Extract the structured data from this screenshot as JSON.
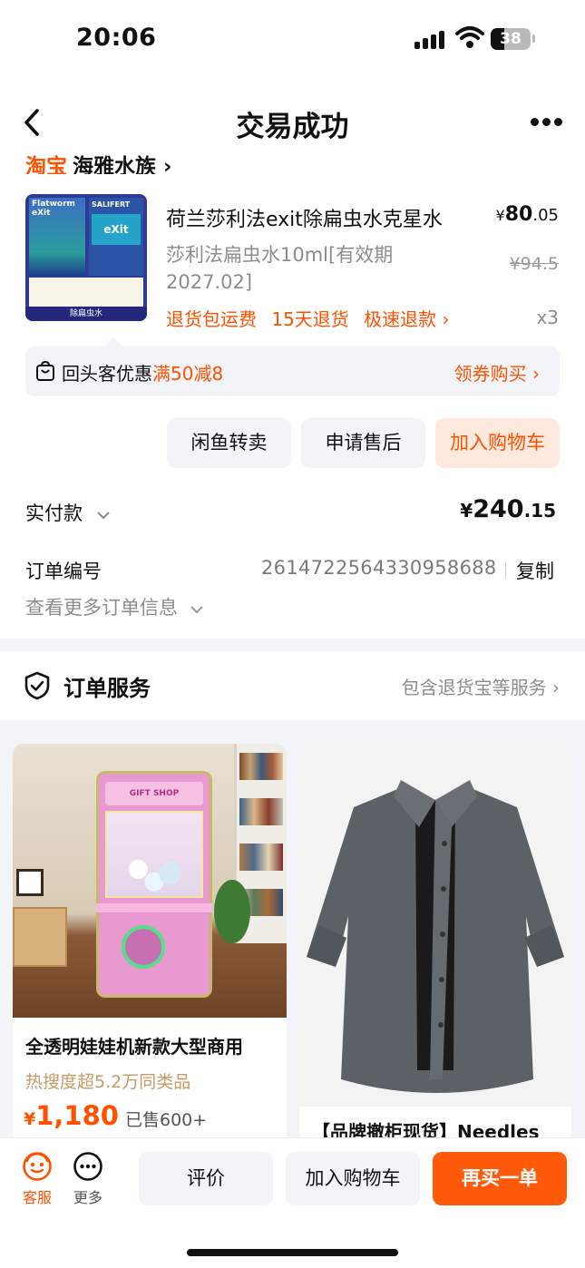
{
  "status_bar": {
    "time": "20:06",
    "battery": "38"
  },
  "nav": {
    "title": "交易成功"
  },
  "shop": {
    "platform": "淘宝",
    "name": "海雅水族"
  },
  "product": {
    "name": "荷兰莎利法exit除扁虫水克星水",
    "price_symbol": "¥",
    "price_int": "80",
    "price_dec": ".05",
    "spec": "莎利法扁虫水10ml[有效期2027.02]",
    "original_price": "¥94.5",
    "tags": [
      "退货包运费",
      "15天退货",
      "极速退款 ›"
    ],
    "quantity": "x3",
    "image_texts": {
      "brand_left": "Flatworm eXit",
      "brand_right": "SALIFERT",
      "label_cn": "除扁虫水",
      "label_en": "eXit",
      "band": "除扁虫水"
    }
  },
  "coupon": {
    "prefix": "回头客优惠",
    "highlight": "满50减8",
    "action": "领券购买 ›"
  },
  "actions": [
    "闲鱼转卖",
    "申请售后",
    "加入购物车"
  ],
  "payment": {
    "label": "实付款",
    "symbol": "¥",
    "int": "240",
    "dec": ".15"
  },
  "order": {
    "label": "订单编号",
    "number": "2614722564330958688",
    "copy": "复制",
    "more": "查看更多订单信息"
  },
  "service": {
    "title": "订单服务",
    "link": "包含退货宝等服务 ›"
  },
  "recommend": [
    {
      "title": "全透明娃娃机新款大型商用",
      "heat": "热搜度超5.2万同类品",
      "price_symbol": "¥",
      "price": "1,180",
      "sold": "已售600+",
      "image_text": "GIFT SHOP"
    },
    {
      "title": "【品牌撤柜现货】Needles"
    }
  ],
  "bottom_bar": {
    "service_label": "客服",
    "more_label": "更多",
    "buttons": [
      "评价",
      "加入购物车",
      "再买一单"
    ]
  },
  "colors": {
    "accent": "#ff5000",
    "bg_gray": "#f2f4f7"
  }
}
